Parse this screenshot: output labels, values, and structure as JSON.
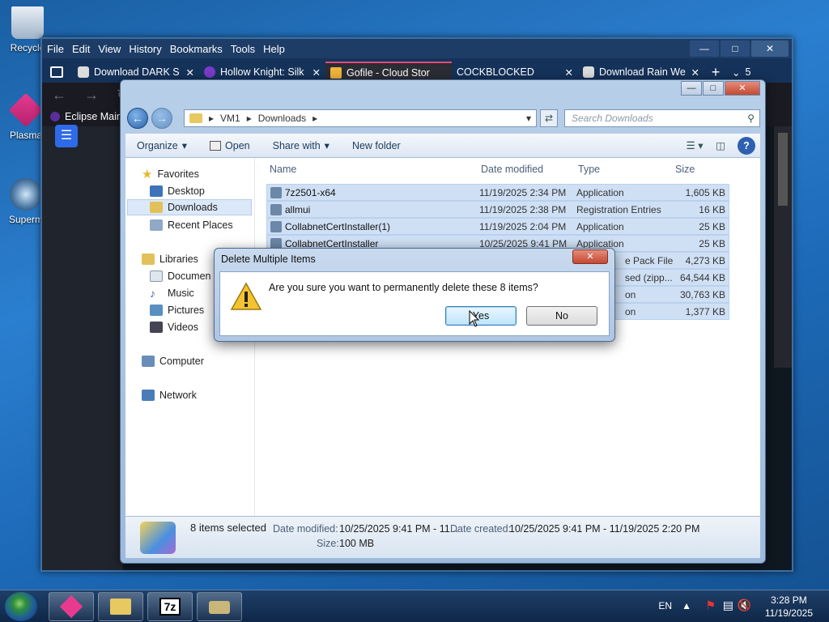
{
  "desktop": {
    "icons": [
      {
        "label": "Recycle",
        "icon": "recycle-bin-icon"
      },
      {
        "label": "Plasma",
        "icon": "plasma-icon"
      },
      {
        "label": "Superm",
        "icon": "superm-icon"
      }
    ]
  },
  "browser": {
    "menu": [
      "File",
      "Edit",
      "View",
      "History",
      "Bookmarks",
      "Tools",
      "Help"
    ],
    "tabs": [
      {
        "label": "Download DARK S",
        "icon": "database-icon"
      },
      {
        "label": "Hollow Knight: Silk",
        "icon": "hollow-knight-icon"
      },
      {
        "label": "Gofile - Cloud Stor",
        "icon": "gofile-icon"
      },
      {
        "label": "COCKBLOCKED",
        "icon": ""
      },
      {
        "label": "Download Rain We",
        "icon": "database-icon"
      }
    ],
    "tab_count": "5",
    "bookmark": "Eclipse Main"
  },
  "explorer": {
    "path": [
      "VM1",
      "Downloads"
    ],
    "search_placeholder": "Search Downloads",
    "toolbar": {
      "organize": "Organize",
      "open": "Open",
      "share": "Share with",
      "new_folder": "New folder"
    },
    "nav": {
      "favorites": "Favorites",
      "desktop": "Desktop",
      "downloads": "Downloads",
      "recent": "Recent Places",
      "libraries": "Libraries",
      "documents": "Documen",
      "music": "Music",
      "pictures": "Pictures",
      "videos": "Videos",
      "computer": "Computer",
      "network": "Network"
    },
    "columns": {
      "name": "Name",
      "date": "Date modified",
      "type": "Type",
      "size": "Size"
    },
    "files": [
      {
        "name": "7z2501-x64",
        "date": "11/19/2025 2:34 PM",
        "type": "Application",
        "size": "1,605 KB"
      },
      {
        "name": "allmui",
        "date": "11/19/2025 2:38 PM",
        "type": "Registration Entries",
        "size": "16 KB"
      },
      {
        "name": "CollabnetCertInstaller(1)",
        "date": "11/19/2025 2:04 PM",
        "type": "Application",
        "size": "25 KB"
      },
      {
        "name": "CollabnetCertInstaller",
        "date": "10/25/2025 9:41 PM",
        "type": "Application",
        "size": "25 KB"
      },
      {
        "name": "",
        "date": "",
        "type": "e Pack File",
        "size": "4,273 KB"
      },
      {
        "name": "",
        "date": "",
        "type": "sed (zipp...",
        "size": "64,544 KB"
      },
      {
        "name": "",
        "date": "",
        "type": "on",
        "size": "30,763 KB"
      },
      {
        "name": "",
        "date": "",
        "type": "on",
        "size": "1,377 KB"
      }
    ],
    "details": {
      "selected": "8 items selected",
      "date_modified_label": "Date modified:",
      "date_modified": "10/25/2025 9:41 PM - 11...",
      "date_created_label": "Date created:",
      "date_created": "10/25/2025 9:41 PM - 11/19/2025 2:20 PM",
      "size_label": "Size:",
      "size": "100 MB"
    }
  },
  "dialog": {
    "title": "Delete Multiple Items",
    "message": "Are you sure you want to permanently delete these 8 items?",
    "yes": "Yes",
    "no": "No"
  },
  "taskbar": {
    "lang": "EN",
    "time": "3:28 PM",
    "date": "11/19/2025"
  }
}
